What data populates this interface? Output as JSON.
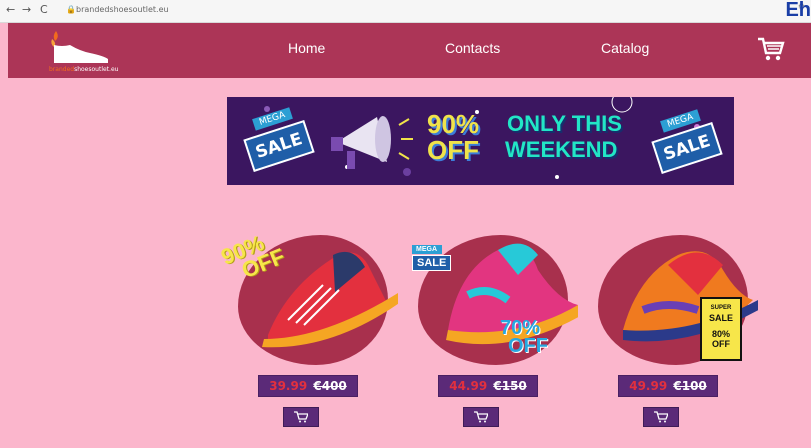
{
  "browser": {
    "url": "brandedshoesoutlet.eu",
    "corner_logo": "Eh"
  },
  "header": {
    "logo_text_part1": "branded",
    "logo_text_part2": "shoesoutlet.eu",
    "nav": [
      "Home",
      "Contacts",
      "Catalog"
    ]
  },
  "banner": {
    "mega_left": "MEGA",
    "sale_left": "SALE",
    "off_line1": "90%",
    "off_line2": "OFF",
    "headline_line1": "ONLY THIS",
    "headline_line2": "WEEKEND",
    "mega_right": "MEGA",
    "sale_right": "SALE"
  },
  "products": [
    {
      "new_price": "39.99",
      "old_price": "€400",
      "badge": [
        "90%",
        "OFF"
      ]
    },
    {
      "new_price": "44.99",
      "old_price": "€150",
      "badge_mega": "MEGA",
      "badge_sale": "SALE",
      "badge2": [
        "70%",
        "OFF"
      ]
    },
    {
      "new_price": "49.99",
      "old_price": "€100",
      "badge": [
        "SUPER",
        "SALE",
        "80%",
        "OFF"
      ]
    }
  ],
  "colors": {
    "page_bg": "#fbb6cc",
    "header_bg": "#ac3557",
    "button_bg": "#5b2a78",
    "new_price": "#e3303e"
  }
}
